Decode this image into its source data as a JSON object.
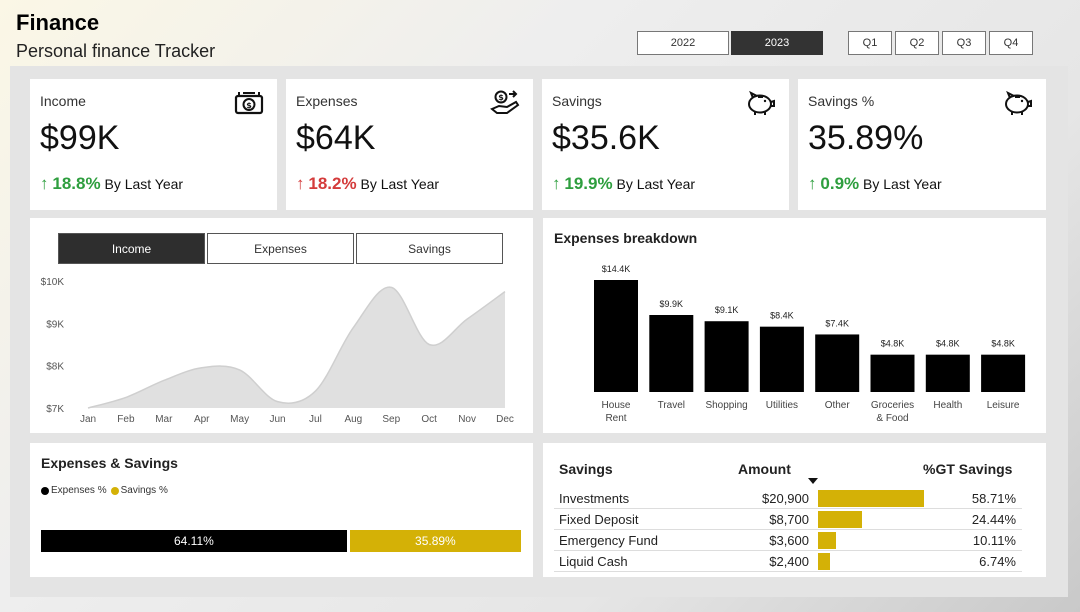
{
  "header": {
    "title": "Finance",
    "subtitle": "Personal finance Tracker"
  },
  "years": [
    {
      "label": "2022",
      "active": false
    },
    {
      "label": "2023",
      "active": true
    }
  ],
  "quarters": [
    "Q1",
    "Q2",
    "Q3",
    "Q4"
  ],
  "kpis": [
    {
      "label": "Income",
      "value": "$99K",
      "trend_arrow": "↑",
      "trend_pct": "18.8%",
      "trend_text": "By Last Year",
      "trend_color": "#2e9e3e",
      "icon": "money-icon"
    },
    {
      "label": "Expenses",
      "value": "$64K",
      "trend_arrow": "↑",
      "trend_pct": "18.2%",
      "trend_text": "By Last Year",
      "trend_color": "#d43b3b",
      "icon": "hand-money-icon"
    },
    {
      "label": "Savings",
      "value": "$35.6K",
      "trend_arrow": "↑",
      "trend_pct": "19.9%",
      "trend_text": "By Last Year",
      "trend_color": "#2e9e3e",
      "icon": "piggy-bank-icon"
    },
    {
      "label": "Savings %",
      "value": "35.89%",
      "trend_arrow": "↑",
      "trend_pct": "0.9%",
      "trend_text": "By Last Year",
      "trend_color": "#2e9e3e",
      "icon": "piggy-bank-icon"
    }
  ],
  "trend_tabs": [
    {
      "label": "Income",
      "active": true
    },
    {
      "label": "Expenses",
      "active": false
    },
    {
      "label": "Savings",
      "active": false
    }
  ],
  "expenses_savings": {
    "title": "Expenses & Savings",
    "legend": [
      {
        "label": "Expenses %",
        "color": "#000000"
      },
      {
        "label": "Savings %",
        "color": "#d4b106"
      }
    ],
    "expenses_pct": 64.11,
    "savings_pct": 35.89,
    "expenses_label": "64.11%",
    "savings_label": "35.89%"
  },
  "savings_table": {
    "headers": {
      "name": "Savings",
      "amount": "Amount",
      "gt": "%GT Savings"
    },
    "rows": [
      {
        "name": "Investments",
        "amount": "$20,900",
        "pct": 58.71,
        "pct_label": "58.71%"
      },
      {
        "name": "Fixed Deposit",
        "amount": "$8,700",
        "pct": 24.44,
        "pct_label": "24.44%"
      },
      {
        "name": "Emergency Fund",
        "amount": "$3,600",
        "pct": 10.11,
        "pct_label": "10.11%"
      },
      {
        "name": "Liquid Cash",
        "amount": "$2,400",
        "pct": 6.74,
        "pct_label": "6.74%"
      }
    ]
  },
  "chart_data": [
    {
      "type": "area",
      "title": "",
      "categories": [
        "Jan",
        "Feb",
        "Mar",
        "Apr",
        "May",
        "Jun",
        "Jul",
        "Aug",
        "Sep",
        "Oct",
        "Nov",
        "Dec"
      ],
      "values": [
        7000,
        7250,
        7650,
        7950,
        7900,
        7150,
        7400,
        8900,
        9850,
        8500,
        9100,
        9750
      ],
      "ylim": [
        7000,
        10000
      ],
      "yticks": [
        7000,
        8000,
        9000,
        10000
      ],
      "ytick_labels": [
        "$7K",
        "$8K",
        "$9K",
        "$10K"
      ],
      "color": "#e0e0e0"
    },
    {
      "type": "bar",
      "title": "Expenses breakdown",
      "categories": [
        "House Rent",
        "Travel",
        "Shopping",
        "Utilities",
        "Other",
        "Groceries & Food",
        "Health",
        "Leisure"
      ],
      "category_lines": [
        [
          "House",
          "Rent"
        ],
        [
          "Travel"
        ],
        [
          "Shopping"
        ],
        [
          "Utilities"
        ],
        [
          "Other"
        ],
        [
          "Groceries",
          "& Food"
        ],
        [
          "Health"
        ],
        [
          "Leisure"
        ]
      ],
      "values": [
        14400,
        9900,
        9100,
        8400,
        7400,
        4800,
        4800,
        4800
      ],
      "labels": [
        "$14.4K",
        "$9.9K",
        "$9.1K",
        "$8.4K",
        "$7.4K",
        "$4.8K",
        "$4.8K",
        "$4.8K"
      ],
      "color": "#000000"
    }
  ]
}
